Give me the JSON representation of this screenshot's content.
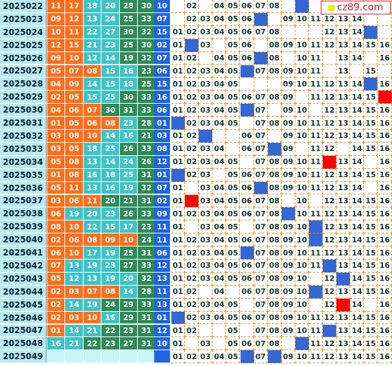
{
  "site": {
    "logo_text": "cz89.com"
  },
  "rows": [
    {
      "issue": "2025022",
      "front": [
        "11",
        "17",
        "18",
        "20",
        "28",
        "30"
      ],
      "back": "10",
      "balls": [
        null,
        "02",
        null,
        "04",
        "05",
        "06",
        "07",
        "08",
        null,
        "10",
        null,
        null,
        null,
        null,
        null,
        null
      ],
      "hl": [
        10
      ],
      "red": []
    },
    {
      "issue": "2025023",
      "front": [
        "09",
        "12",
        "13",
        "24",
        "25",
        "33"
      ],
      "back": "07",
      "balls": [
        null,
        "02",
        "03",
        "04",
        "05",
        "06",
        "07",
        null,
        "09",
        "10",
        "11",
        "12",
        "13",
        "14",
        null,
        null
      ],
      "hl": [
        7
      ],
      "red": []
    },
    {
      "issue": "2025024",
      "front": [
        "10",
        "11",
        "22",
        "27",
        "30",
        "32"
      ],
      "back": "15",
      "balls": [
        "01",
        "02",
        "03",
        "04",
        "05",
        "06",
        "07",
        "08",
        null,
        null,
        null,
        "12",
        "13",
        "14",
        "15",
        null
      ],
      "hl": [
        15
      ],
      "red": []
    },
    {
      "issue": "2025025",
      "front": [
        "12",
        "15",
        "21",
        "23",
        "25",
        "30"
      ],
      "back": "02",
      "balls": [
        "01",
        "02",
        "03",
        null,
        "05",
        "06",
        null,
        "08",
        "09",
        "10",
        "11",
        "12",
        "13",
        "14",
        "15",
        "16"
      ],
      "hl": [
        2
      ],
      "red": []
    },
    {
      "issue": "2025026",
      "front": [
        "09",
        "10",
        "12",
        "14",
        "19",
        "32"
      ],
      "back": "07",
      "balls": [
        "01",
        "02",
        null,
        "04",
        "05",
        "06",
        "07",
        "08",
        null,
        "10",
        "11",
        null,
        "13",
        "14",
        null,
        "16"
      ],
      "hl": [
        7
      ],
      "red": []
    },
    {
      "issue": "2025027",
      "front": [
        "05",
        "07",
        "08",
        "15",
        "16",
        "23"
      ],
      "back": "06",
      "balls": [
        "01",
        "02",
        "03",
        "04",
        "05",
        "06",
        "07",
        "08",
        "09",
        "10",
        "11",
        null,
        "13",
        null,
        "15",
        null
      ],
      "hl": [
        6
      ],
      "red": []
    },
    {
      "issue": "2025028",
      "front": [
        "04",
        "09",
        "14",
        "15",
        "18",
        "25"
      ],
      "back": "15",
      "balls": [
        "01",
        "02",
        "03",
        "04",
        "05",
        null,
        null,
        null,
        "09",
        "10",
        "11",
        "12",
        "13",
        "14",
        "15",
        "16"
      ],
      "hl": [
        15
      ],
      "red": []
    },
    {
      "issue": "2025029",
      "front": [
        "02",
        "05",
        "15",
        "25",
        "30",
        "33"
      ],
      "back": "16",
      "balls": [
        "01",
        "02",
        "03",
        "04",
        "05",
        "06",
        "07",
        "08",
        "09",
        null,
        "11",
        "12",
        "13",
        "14",
        "15",
        null
      ],
      "hl": [],
      "red": [
        16
      ]
    },
    {
      "issue": "2025030",
      "front": [
        "04",
        "06",
        "07",
        "30",
        "31",
        "33"
      ],
      "back": "06",
      "balls": [
        "01",
        "02",
        "03",
        "04",
        "05",
        "06",
        "07",
        null,
        "09",
        "10",
        null,
        "12",
        "13",
        "14",
        "15",
        "16"
      ],
      "hl": [
        6
      ],
      "red": []
    },
    {
      "issue": "2025031",
      "front": [
        "01",
        "05",
        "06",
        "08",
        "23",
        "28"
      ],
      "back": "01",
      "balls": [
        "01",
        "02",
        "03",
        "04",
        "05",
        null,
        "07",
        "08",
        "09",
        "10",
        "11",
        "12",
        "13",
        "14",
        "15",
        "16"
      ],
      "hl": [
        1
      ],
      "red": []
    },
    {
      "issue": "2025032",
      "front": [
        "03",
        "08",
        "10",
        "14",
        "16",
        "21"
      ],
      "back": "03",
      "balls": [
        "01",
        "02",
        "03",
        null,
        null,
        "06",
        "07",
        null,
        "09",
        "10",
        "11",
        "12",
        "13",
        "14",
        "15",
        "16"
      ],
      "hl": [
        3
      ],
      "red": []
    },
    {
      "issue": "2025033",
      "front": [
        "03",
        "05",
        "18",
        "25",
        "26",
        "33"
      ],
      "back": "08",
      "balls": [
        "01",
        "02",
        "03",
        "04",
        null,
        "06",
        "07",
        "08",
        "09",
        null,
        "11",
        "12",
        null,
        "14",
        "15",
        "16"
      ],
      "hl": [
        8
      ],
      "red": []
    },
    {
      "issue": "2025034",
      "front": [
        "05",
        "08",
        "13",
        "14",
        "24",
        "26"
      ],
      "back": "12",
      "balls": [
        "01",
        "02",
        "03",
        "04",
        "05",
        null,
        "07",
        "08",
        "09",
        "10",
        "11",
        null,
        "13",
        "14",
        null,
        "16"
      ],
      "hl": [],
      "red": [
        12
      ]
    },
    {
      "issue": "2025035",
      "front": [
        "01",
        "08",
        "16",
        "18",
        "25",
        "31"
      ],
      "back": "01",
      "balls": [
        "01",
        "02",
        "03",
        null,
        "05",
        "06",
        "07",
        "08",
        "09",
        "10",
        "11",
        "12",
        "13",
        "14",
        "15",
        "16"
      ],
      "hl": [
        1
      ],
      "red": []
    },
    {
      "issue": "2025036",
      "front": [
        "05",
        "11",
        "13",
        "16",
        "19",
        "32"
      ],
      "back": "07",
      "balls": [
        "01",
        null,
        "03",
        "04",
        "05",
        "06",
        "07",
        "08",
        "09",
        "10",
        "11",
        "12",
        "13",
        "14",
        null,
        "16"
      ],
      "hl": [
        7
      ],
      "red": []
    },
    {
      "issue": "2025037",
      "front": [
        "03",
        "06",
        "11",
        "20",
        "21",
        "31"
      ],
      "back": "02",
      "balls": [
        "01",
        null,
        "03",
        "04",
        "05",
        "06",
        "07",
        "08",
        null,
        "10",
        null,
        "12",
        "13",
        "14",
        "15",
        "16"
      ],
      "hl": [],
      "red": [
        2
      ]
    },
    {
      "issue": "2025038",
      "front": [
        "06",
        "19",
        "20",
        "23",
        "26",
        "33"
      ],
      "back": "09",
      "balls": [
        "01",
        "02",
        "03",
        "04",
        "05",
        "06",
        "07",
        "08",
        "09",
        "10",
        "11",
        "12",
        "13",
        "14",
        "15",
        "16"
      ],
      "hl": [
        9
      ],
      "red": []
    },
    {
      "issue": "2025039",
      "front": [
        "08",
        "10",
        "12",
        "15",
        "17",
        "23"
      ],
      "back": "11",
      "balls": [
        "01",
        null,
        "03",
        "04",
        "05",
        null,
        "07",
        "08",
        "09",
        "10",
        "11",
        "12",
        "13",
        "14",
        "15",
        "16"
      ],
      "hl": [
        11
      ],
      "red": []
    },
    {
      "issue": "2025040",
      "front": [
        "02",
        "06",
        "08",
        "09",
        "10",
        "24"
      ],
      "back": "11",
      "balls": [
        "01",
        "02",
        "03",
        "04",
        "05",
        "06",
        "07",
        "08",
        "09",
        "10",
        "11",
        "12",
        "13",
        "14",
        "15",
        "16"
      ],
      "hl": [
        11
      ],
      "red": []
    },
    {
      "issue": "2025041",
      "front": [
        "06",
        "10",
        "17",
        "19",
        "25",
        "31"
      ],
      "back": "06",
      "balls": [
        "01",
        "02",
        "03",
        "04",
        "05",
        "06",
        "07",
        "08",
        "09",
        "10",
        "11",
        "12",
        "13",
        "14",
        "15",
        "16"
      ],
      "hl": [
        6
      ],
      "red": []
    },
    {
      "issue": "2025042",
      "front": [
        "07",
        "13",
        "19",
        "23",
        "27",
        "33"
      ],
      "back": "12",
      "balls": [
        "01",
        "02",
        "03",
        "04",
        "05",
        "06",
        "07",
        "08",
        "09",
        "10",
        "11",
        "12",
        "13",
        "14",
        "15",
        "16"
      ],
      "hl": [
        12
      ],
      "red": []
    },
    {
      "issue": "2025043",
      "front": [
        "05",
        "12",
        "13",
        "19",
        "20",
        "32"
      ],
      "back": "13",
      "balls": [
        "01",
        "02",
        "03",
        "04",
        "05",
        "06",
        "07",
        "08",
        "09",
        "10",
        null,
        "12",
        "13",
        "14",
        "15",
        "16"
      ],
      "hl": [
        13
      ],
      "red": []
    },
    {
      "issue": "2025044",
      "front": [
        "02",
        "03",
        "07",
        "08",
        "14",
        "28"
      ],
      "back": "11",
      "balls": [
        "01",
        "02",
        null,
        "04",
        null,
        "06",
        "07",
        "08",
        "09",
        "10",
        "11",
        "12",
        "13",
        "14",
        "15",
        "16"
      ],
      "hl": [
        11
      ],
      "red": []
    },
    {
      "issue": "2025045",
      "front": [
        "02",
        "14",
        "19",
        "24",
        "29",
        "33"
      ],
      "back": "13",
      "balls": [
        "01",
        "02",
        "03",
        "04",
        "05",
        null,
        "07",
        "08",
        "09",
        "10",
        null,
        "12",
        null,
        "14",
        null,
        "16"
      ],
      "hl": [],
      "red": [
        13
      ]
    },
    {
      "issue": "2025046",
      "front": [
        "02",
        "03",
        "10",
        "16",
        "29",
        "31"
      ],
      "back": "01",
      "balls": [
        "01",
        "02",
        "03",
        "04",
        "05",
        "06",
        "07",
        "08",
        "09",
        "10",
        "11",
        "12",
        "13",
        "14",
        "15",
        "16"
      ],
      "hl": [
        1
      ],
      "red": []
    },
    {
      "issue": "2025047",
      "front": [
        "01",
        "14",
        "21",
        "22",
        "23",
        "31"
      ],
      "back": "12",
      "balls": [
        "01",
        "02",
        null,
        null,
        "05",
        null,
        "07",
        "08",
        "09",
        "10",
        "11",
        "12",
        "13",
        "14",
        "15",
        "16"
      ],
      "hl": [
        12
      ],
      "red": []
    },
    {
      "issue": "2025048",
      "front": [
        "16",
        "21",
        "22",
        "23",
        "27",
        "31"
      ],
      "back": "10",
      "balls": [
        "01",
        null,
        "03",
        null,
        "05",
        "06",
        "07",
        "08",
        null,
        "10",
        "11",
        "12",
        "13",
        "14",
        "15",
        "16"
      ],
      "hl": [
        10
      ],
      "red": []
    },
    {
      "issue": "2025049",
      "front": [
        null,
        null,
        null,
        null,
        null,
        null
      ],
      "back": null,
      "balls": [
        "01",
        "02",
        "03",
        "04",
        "05",
        null,
        "07",
        null,
        "09",
        "10",
        "11",
        "12",
        "13",
        "14",
        "15",
        "16"
      ],
      "hl": [
        6,
        8
      ],
      "red": [],
      "future": true
    }
  ],
  "front_color_pattern": [
    [
      "r1",
      "r1",
      "r2",
      "r2",
      "r3",
      "r3"
    ],
    [
      "r1",
      "r1",
      "r2",
      "r2",
      "r3",
      "r3"
    ],
    [
      "r1",
      "r1",
      "r2",
      "r2",
      "r3",
      "r3"
    ],
    [
      "r1",
      "r1",
      "r2",
      "r2",
      "r3",
      "r3"
    ],
    [
      "r1",
      "r1",
      "r2",
      "r2",
      "r3",
      "r3"
    ],
    [
      "r1",
      "r1",
      "r1",
      "r2",
      "r2",
      "r3"
    ],
    [
      "r1",
      "r1",
      "r2",
      "r2",
      "r2",
      "r3"
    ],
    [
      "r1",
      "r1",
      "r2",
      "r2",
      "r3",
      "r3"
    ],
    [
      "r1",
      "r1",
      "r1",
      "r3",
      "r3",
      "r3"
    ],
    [
      "r1",
      "r1",
      "r1",
      "r1",
      "r2",
      "r3"
    ],
    [
      "r1",
      "r1",
      "r1",
      "r2",
      "r2",
      "r3"
    ],
    [
      "r1",
      "r1",
      "r2",
      "r2",
      "r3",
      "r3"
    ],
    [
      "r1",
      "r1",
      "r2",
      "r2",
      "r2",
      "r3"
    ],
    [
      "r1",
      "r1",
      "r2",
      "r2",
      "r2",
      "r3"
    ],
    [
      "r1",
      "r1",
      "r2",
      "r2",
      "r2",
      "r3"
    ],
    [
      "r1",
      "r1",
      "r1",
      "r3",
      "r3",
      "r3"
    ],
    [
      "r1",
      "r2",
      "r2",
      "r2",
      "r3",
      "r3"
    ],
    [
      "r1",
      "r1",
      "r2",
      "r2",
      "r2",
      "r3"
    ],
    [
      "r1",
      "r1",
      "r1",
      "r1",
      "r1",
      "r3"
    ],
    [
      "r1",
      "r1",
      "r2",
      "r2",
      "r3",
      "r3"
    ],
    [
      "r1",
      "r2",
      "r2",
      "r2",
      "r3",
      "r3"
    ],
    [
      "r1",
      "r2",
      "r2",
      "r2",
      "r2",
      "r3"
    ],
    [
      "r1",
      "r1",
      "r1",
      "r1",
      "r2",
      "r3"
    ],
    [
      "r1",
      "r2",
      "r2",
      "r3",
      "r3",
      "r3"
    ],
    [
      "r1",
      "r1",
      "r1",
      "r2",
      "r3",
      "r3"
    ],
    [
      "r1",
      "r2",
      "r2",
      "r3",
      "r3",
      "r3"
    ],
    [
      "r2",
      "r2",
      "r3",
      "r3",
      "r3",
      "r3"
    ],
    [
      "e",
      "e",
      "e",
      "e",
      "e",
      "e"
    ]
  ],
  "colors": {
    "orange": "#ff6e1b",
    "teal": "#3ec4c8",
    "green": "#2e8b57",
    "blue": "#1f64e0",
    "red": "#ff0000"
  }
}
